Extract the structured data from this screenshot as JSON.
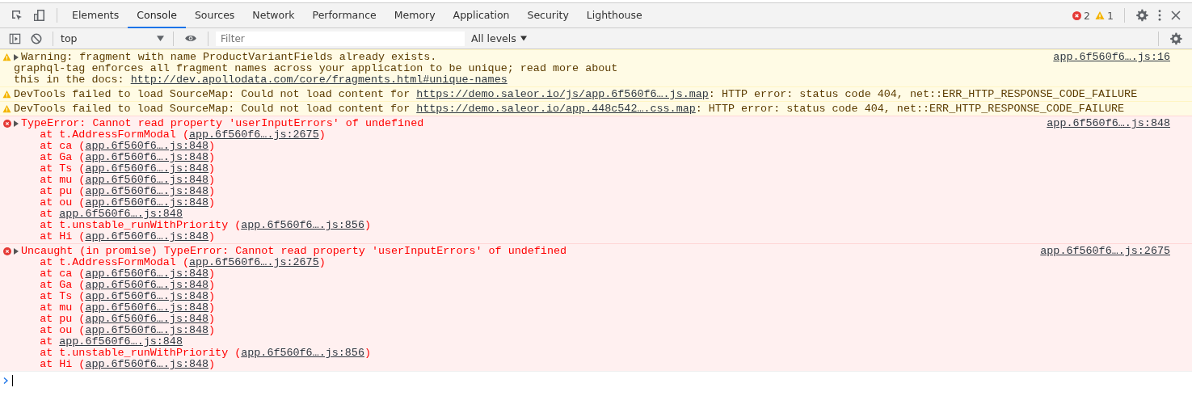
{
  "tabs": [
    {
      "label": "Elements",
      "selected": false
    },
    {
      "label": "Console",
      "selected": true
    },
    {
      "label": "Sources",
      "selected": false
    },
    {
      "label": "Network",
      "selected": false
    },
    {
      "label": "Performance",
      "selected": false
    },
    {
      "label": "Memory",
      "selected": false
    },
    {
      "label": "Application",
      "selected": false
    },
    {
      "label": "Security",
      "selected": false
    },
    {
      "label": "Lighthouse",
      "selected": false
    }
  ],
  "counts": {
    "errors": "2",
    "warnings": "1"
  },
  "toolbar": {
    "context": "top",
    "filter": {
      "placeholder": "Filter"
    },
    "levels": "All levels"
  },
  "messages": [
    {
      "kind": "warning",
      "expanded": false,
      "source": "app.6f560f6….js:16",
      "lines": [
        {
          "text": "Warning: fragment with name ProductVariantFields already exists."
        },
        {
          "text": "graphql-tag enforces all fragment names across your application to be unique; read more about"
        },
        {
          "text": "this in the docs: ",
          "link": "http://dev.apollodata.com/core/fragments.html#unique-names"
        }
      ]
    },
    {
      "kind": "warning",
      "lines": [
        {
          "text": "DevTools failed to load SourceMap: Could not load content for ",
          "link": "https://demo.saleor.io/js/app.6f560f6….js.map",
          "suffix": ": HTTP error: status code 404, net::ERR_HTTP_RESPONSE_CODE_FAILURE"
        }
      ]
    },
    {
      "kind": "warning",
      "lines": [
        {
          "text": "DevTools failed to load SourceMap: Could not load content for ",
          "link": "https://demo.saleor.io/app.448c542….css.map",
          "suffix": ": HTTP error: status code 404, net::ERR_HTTP_RESPONSE_CODE_FAILURE"
        }
      ]
    },
    {
      "kind": "error",
      "expanded": false,
      "source": "app.6f560f6….js:848",
      "lines": [
        {
          "text": "TypeError: Cannot read property 'userInputErrors' of undefined"
        },
        {
          "text": "    at t.AddressFormModal (",
          "link": "app.6f560f6….js:2675",
          "suffix": ")"
        },
        {
          "text": "    at ca (",
          "link": "app.6f560f6….js:848",
          "suffix": ")"
        },
        {
          "text": "    at Ga (",
          "link": "app.6f560f6….js:848",
          "suffix": ")"
        },
        {
          "text": "    at Ts (",
          "link": "app.6f560f6….js:848",
          "suffix": ")"
        },
        {
          "text": "    at mu (",
          "link": "app.6f560f6….js:848",
          "suffix": ")"
        },
        {
          "text": "    at pu (",
          "link": "app.6f560f6….js:848",
          "suffix": ")"
        },
        {
          "text": "    at ou (",
          "link": "app.6f560f6….js:848",
          "suffix": ")"
        },
        {
          "text": "    at ",
          "link": "app.6f560f6….js:848"
        },
        {
          "text": "    at t.unstable_runWithPriority (",
          "link": "app.6f560f6….js:856",
          "suffix": ")"
        },
        {
          "text": "    at Hi (",
          "link": "app.6f560f6….js:848",
          "suffix": ")"
        }
      ]
    },
    {
      "kind": "error",
      "expanded": false,
      "source": "app.6f560f6….js:2675",
      "lines": [
        {
          "text": "Uncaught (in promise) TypeError: Cannot read property 'userInputErrors' of undefined"
        },
        {
          "text": "    at t.AddressFormModal (",
          "link": "app.6f560f6….js:2675",
          "suffix": ")"
        },
        {
          "text": "    at ca (",
          "link": "app.6f560f6….js:848",
          "suffix": ")"
        },
        {
          "text": "    at Ga (",
          "link": "app.6f560f6….js:848",
          "suffix": ")"
        },
        {
          "text": "    at Ts (",
          "link": "app.6f560f6….js:848",
          "suffix": ")"
        },
        {
          "text": "    at mu (",
          "link": "app.6f560f6….js:848",
          "suffix": ")"
        },
        {
          "text": "    at pu (",
          "link": "app.6f560f6….js:848",
          "suffix": ")"
        },
        {
          "text": "    at ou (",
          "link": "app.6f560f6….js:848",
          "suffix": ")"
        },
        {
          "text": "    at ",
          "link": "app.6f560f6….js:848"
        },
        {
          "text": "    at t.unstable_runWithPriority (",
          "link": "app.6f560f6….js:856",
          "suffix": ")"
        },
        {
          "text": "    at Hi (",
          "link": "app.6f560f6….js:848",
          "suffix": ")"
        }
      ]
    }
  ]
}
